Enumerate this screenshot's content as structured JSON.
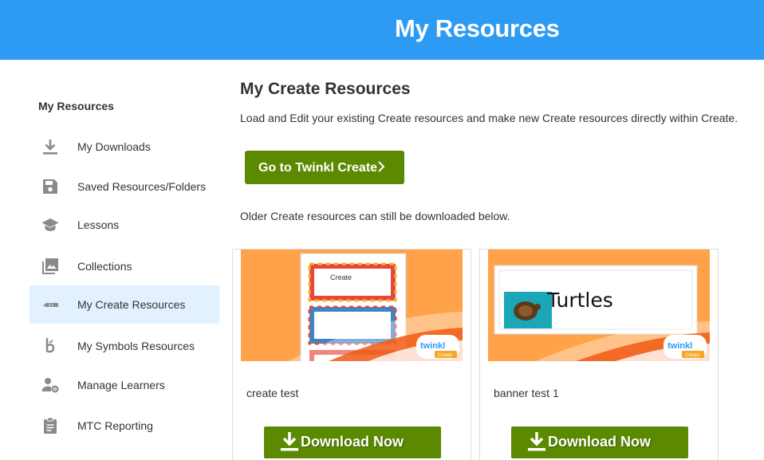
{
  "header": {
    "title": "My Resources"
  },
  "sidebar": {
    "heading": "My Resources",
    "items": [
      {
        "label": "My Downloads",
        "icon": "download-icon"
      },
      {
        "label": "Saved Resources/Folders",
        "icon": "save-icon"
      },
      {
        "label": "Lessons",
        "icon": "graduation-cap-icon"
      },
      {
        "label": "Collections",
        "icon": "image-collection-icon"
      },
      {
        "label": "My Create Resources",
        "icon": "pencil-icon",
        "active": true
      },
      {
        "label": "My Symbols Resources",
        "icon": "symbols-icon"
      },
      {
        "label": "Manage Learners",
        "icon": "user-settings-icon"
      },
      {
        "label": "MTC Reporting",
        "icon": "clipboard-icon"
      }
    ]
  },
  "main": {
    "title": "My Create Resources",
    "description": "Load and Edit your existing Create resources and make new Create resources directly within Create.",
    "go_button": "Go to Twinkl Create",
    "older_text": "Older Create resources can still be downloaded below.",
    "cards": [
      {
        "name": "create test",
        "thumb_text": "Create",
        "download": "Download Now"
      },
      {
        "name": "banner test 1",
        "thumb_text": "Turtles",
        "download": "Download Now"
      }
    ],
    "brand": {
      "logo": "twinkl",
      "sub": "Create"
    }
  },
  "colors": {
    "header": "#2d9af3",
    "button_green": "#5b8a00",
    "active_item": "#e2f1fd",
    "thumb_orange": "#ffa24a"
  }
}
